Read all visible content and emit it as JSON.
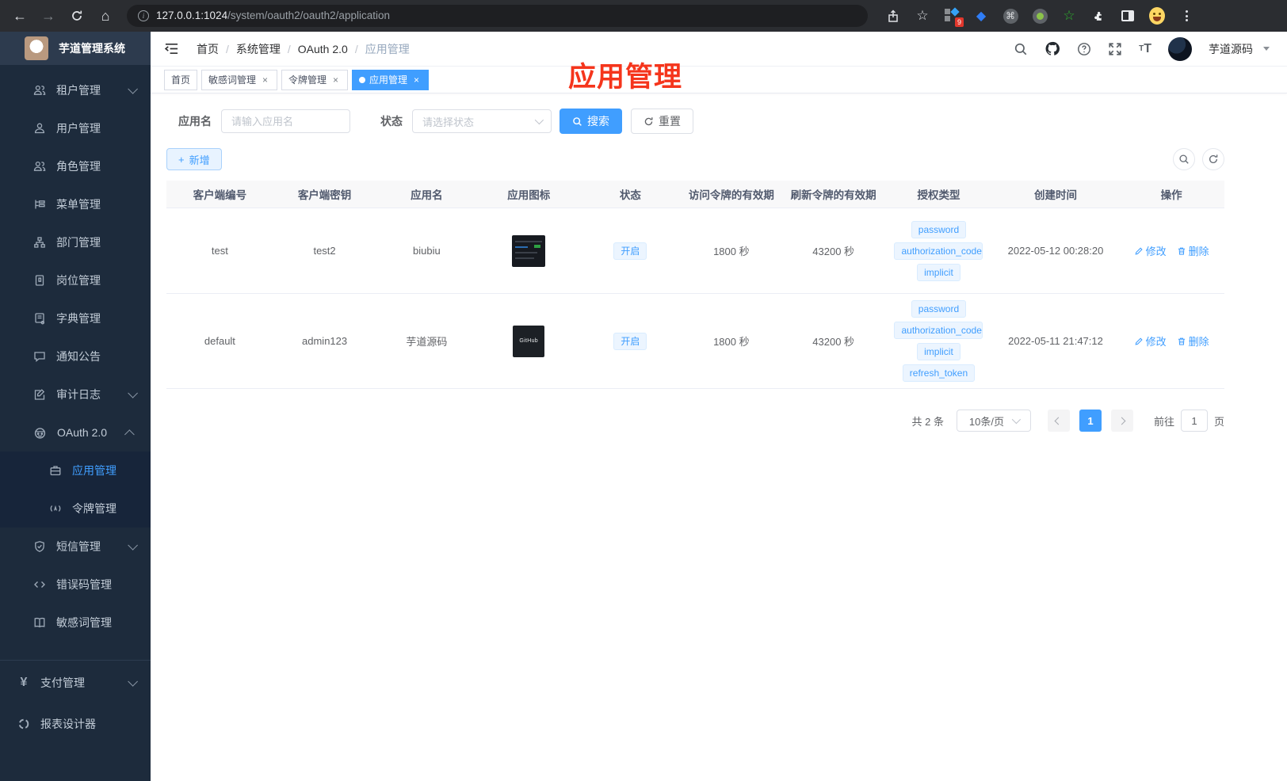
{
  "browser": {
    "url_host": "127.0.0.1:1024",
    "url_path": "/system/oauth2/oauth2/application",
    "extension_badge": "9"
  },
  "sidebar": {
    "title": "芋道管理系统",
    "items": [
      {
        "label": "租户管理"
      },
      {
        "label": "用户管理"
      },
      {
        "label": "角色管理"
      },
      {
        "label": "菜单管理"
      },
      {
        "label": "部门管理"
      },
      {
        "label": "岗位管理"
      },
      {
        "label": "字典管理"
      },
      {
        "label": "通知公告"
      },
      {
        "label": "审计日志"
      },
      {
        "label": "OAuth 2.0"
      },
      {
        "label": "应用管理"
      },
      {
        "label": "令牌管理"
      },
      {
        "label": "短信管理"
      },
      {
        "label": "错误码管理"
      },
      {
        "label": "敏感词管理"
      },
      {
        "label": "支付管理"
      },
      {
        "label": "报表设计器"
      }
    ]
  },
  "navbar": {
    "breadcrumbs": [
      "首页",
      "系统管理",
      "OAuth 2.0",
      "应用管理"
    ],
    "username": "芋道源码"
  },
  "tabs": [
    {
      "label": "首页"
    },
    {
      "label": "敏感词管理"
    },
    {
      "label": "令牌管理"
    },
    {
      "label": "应用管理"
    }
  ],
  "annotation": {
    "text": "应用管理",
    "color": "#f5351c"
  },
  "filters": {
    "name_label": "应用名",
    "name_placeholder": "请输入应用名",
    "status_label": "状态",
    "status_placeholder": "请选择状态",
    "search_label": "搜索",
    "reset_label": "重置",
    "add_label": "新增"
  },
  "table": {
    "headers": [
      "客户端编号",
      "客户端密钥",
      "应用名",
      "应用图标",
      "状态",
      "访问令牌的有效期",
      "刷新令牌的有效期",
      "授权类型",
      "创建时间",
      "操作"
    ],
    "rows": [
      {
        "client_id": "test",
        "secret": "test2",
        "name": "biubiu",
        "status": "开启",
        "access_ttl": "1800 秒",
        "refresh_ttl": "43200 秒",
        "grants": [
          "password",
          "authorization_code",
          "implicit"
        ],
        "created": "2022-05-12 00:28:20"
      },
      {
        "client_id": "default",
        "secret": "admin123",
        "name": "芋道源码",
        "icon_label": "GitHub",
        "status": "开启",
        "access_ttl": "1800 秒",
        "refresh_ttl": "43200 秒",
        "grants": [
          "password",
          "authorization_code",
          "implicit",
          "refresh_token"
        ],
        "created": "2022-05-11 21:47:12"
      }
    ],
    "actions": {
      "edit": "修改",
      "delete": "删除"
    }
  },
  "pagination": {
    "total": "共 2 条",
    "page_size": "10条/页",
    "current_page": "1",
    "goto_label": "前往",
    "goto_value": "1",
    "page_unit": "页"
  },
  "colors": {
    "accent": "#409eff",
    "sidebar_bg": "#1d2b3c",
    "tag_bg": "#ecf5ff"
  }
}
